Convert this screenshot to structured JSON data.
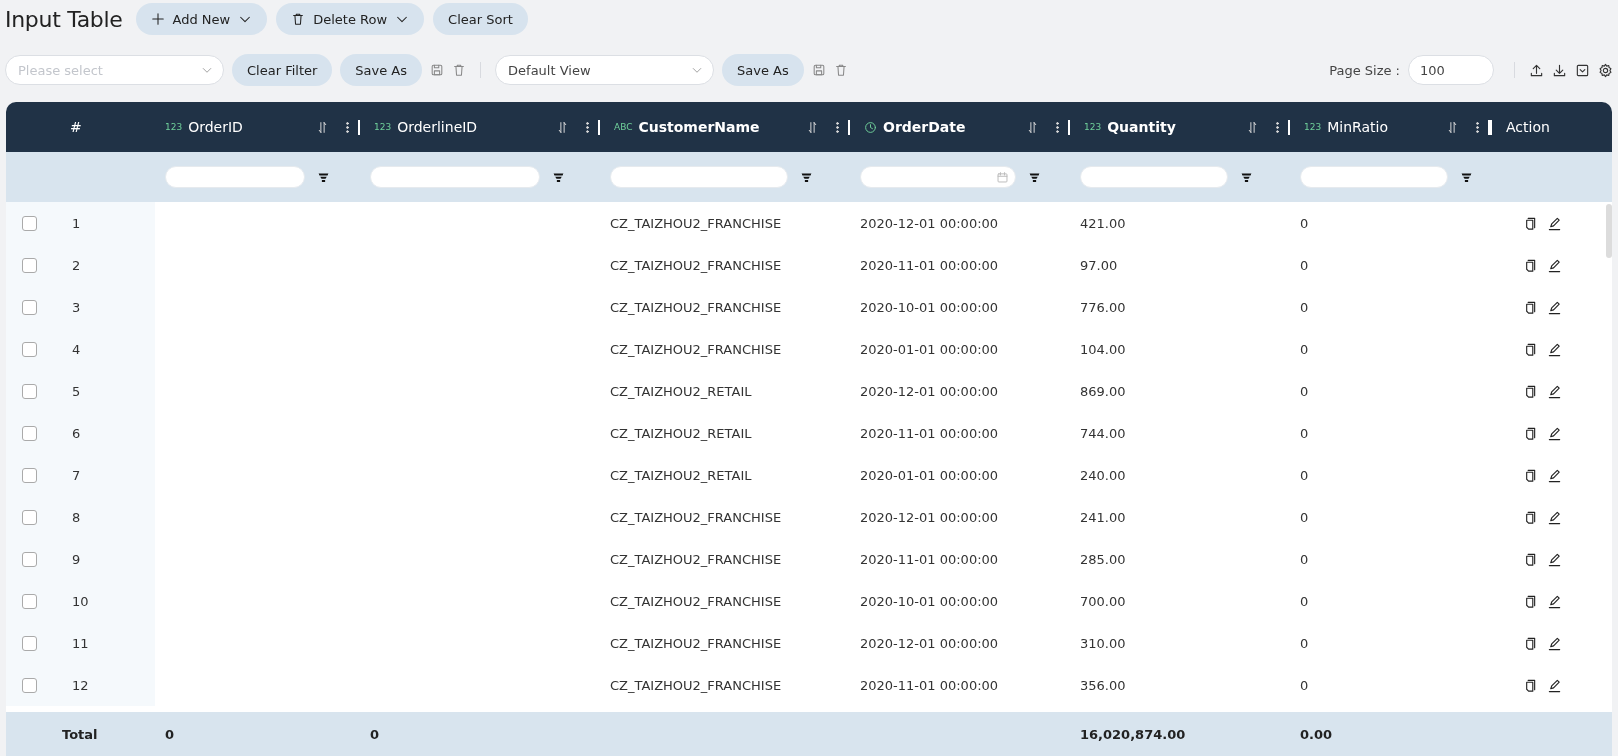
{
  "title": "Input Table",
  "top_buttons": [
    {
      "label": "Add New",
      "kind": "add",
      "menu": true
    },
    {
      "label": "Delete Row",
      "kind": "delete",
      "menu": true
    },
    {
      "label": "Clear Sort",
      "kind": "plain",
      "menu": false
    }
  ],
  "toolbar": {
    "filter_select": {
      "placeholder": "Please select"
    },
    "clear_filter": "Clear Filter",
    "save_as_1": "Save As",
    "view_select": {
      "value": "Default View"
    },
    "save_as_2": "Save As",
    "page_size_label": "Page Size :",
    "page_size": {
      "value": "100"
    }
  },
  "table": {
    "index_header": "#",
    "columns": [
      {
        "kind": "number",
        "badge": "123",
        "label": "OrderID",
        "bold": false
      },
      {
        "kind": "number",
        "badge": "123",
        "label": "OrderlineID",
        "bold": false
      },
      {
        "kind": "text",
        "badge": "ABC",
        "label": "CustomerName",
        "bold": true
      },
      {
        "kind": "date",
        "label": "OrderDate",
        "bold": true
      },
      {
        "kind": "number",
        "badge": "123",
        "label": "Quantity",
        "bold": true
      },
      {
        "kind": "number",
        "badge": "123",
        "label": "MinRatio",
        "bold": false
      }
    ],
    "action_header": "Action",
    "rows": [
      {
        "index": "1",
        "checked": false,
        "cells": [
          "",
          "",
          "CZ_TAIZHOU2_FRANCHISE",
          "2020-12-01 00:00:00",
          "421.00",
          "0"
        ]
      },
      {
        "index": "2",
        "checked": false,
        "cells": [
          "",
          "",
          "CZ_TAIZHOU2_FRANCHISE",
          "2020-11-01 00:00:00",
          "97.00",
          "0"
        ]
      },
      {
        "index": "3",
        "checked": false,
        "cells": [
          "",
          "",
          "CZ_TAIZHOU2_FRANCHISE",
          "2020-10-01 00:00:00",
          "776.00",
          "0"
        ]
      },
      {
        "index": "4",
        "checked": false,
        "cells": [
          "",
          "",
          "CZ_TAIZHOU2_FRANCHISE",
          "2020-01-01 00:00:00",
          "104.00",
          "0"
        ]
      },
      {
        "index": "5",
        "checked": false,
        "cells": [
          "",
          "",
          "CZ_TAIZHOU2_RETAIL",
          "2020-12-01 00:00:00",
          "869.00",
          "0"
        ]
      },
      {
        "index": "6",
        "checked": false,
        "cells": [
          "",
          "",
          "CZ_TAIZHOU2_RETAIL",
          "2020-11-01 00:00:00",
          "744.00",
          "0"
        ]
      },
      {
        "index": "7",
        "checked": false,
        "cells": [
          "",
          "",
          "CZ_TAIZHOU2_RETAIL",
          "2020-01-01 00:00:00",
          "240.00",
          "0"
        ]
      },
      {
        "index": "8",
        "checked": false,
        "cells": [
          "",
          "",
          "CZ_TAIZHOU2_FRANCHISE",
          "2020-12-01 00:00:00",
          "241.00",
          "0"
        ]
      },
      {
        "index": "9",
        "checked": false,
        "cells": [
          "",
          "",
          "CZ_TAIZHOU2_FRANCHISE",
          "2020-11-01 00:00:00",
          "285.00",
          "0"
        ]
      },
      {
        "index": "10",
        "checked": false,
        "cells": [
          "",
          "",
          "CZ_TAIZHOU2_FRANCHISE",
          "2020-10-01 00:00:00",
          "700.00",
          "0"
        ]
      },
      {
        "index": "11",
        "checked": false,
        "cells": [
          "",
          "",
          "CZ_TAIZHOU2_FRANCHISE",
          "2020-12-01 00:00:00",
          "310.00",
          "0"
        ]
      },
      {
        "index": "12",
        "checked": false,
        "cells": [
          "",
          "",
          "CZ_TAIZHOU2_FRANCHISE",
          "2020-11-01 00:00:00",
          "356.00",
          "0"
        ]
      }
    ],
    "totals": {
      "label": "Total",
      "cells": [
        "0",
        "0",
        "",
        "",
        "16,020,874.00",
        "0.00"
      ]
    }
  }
}
